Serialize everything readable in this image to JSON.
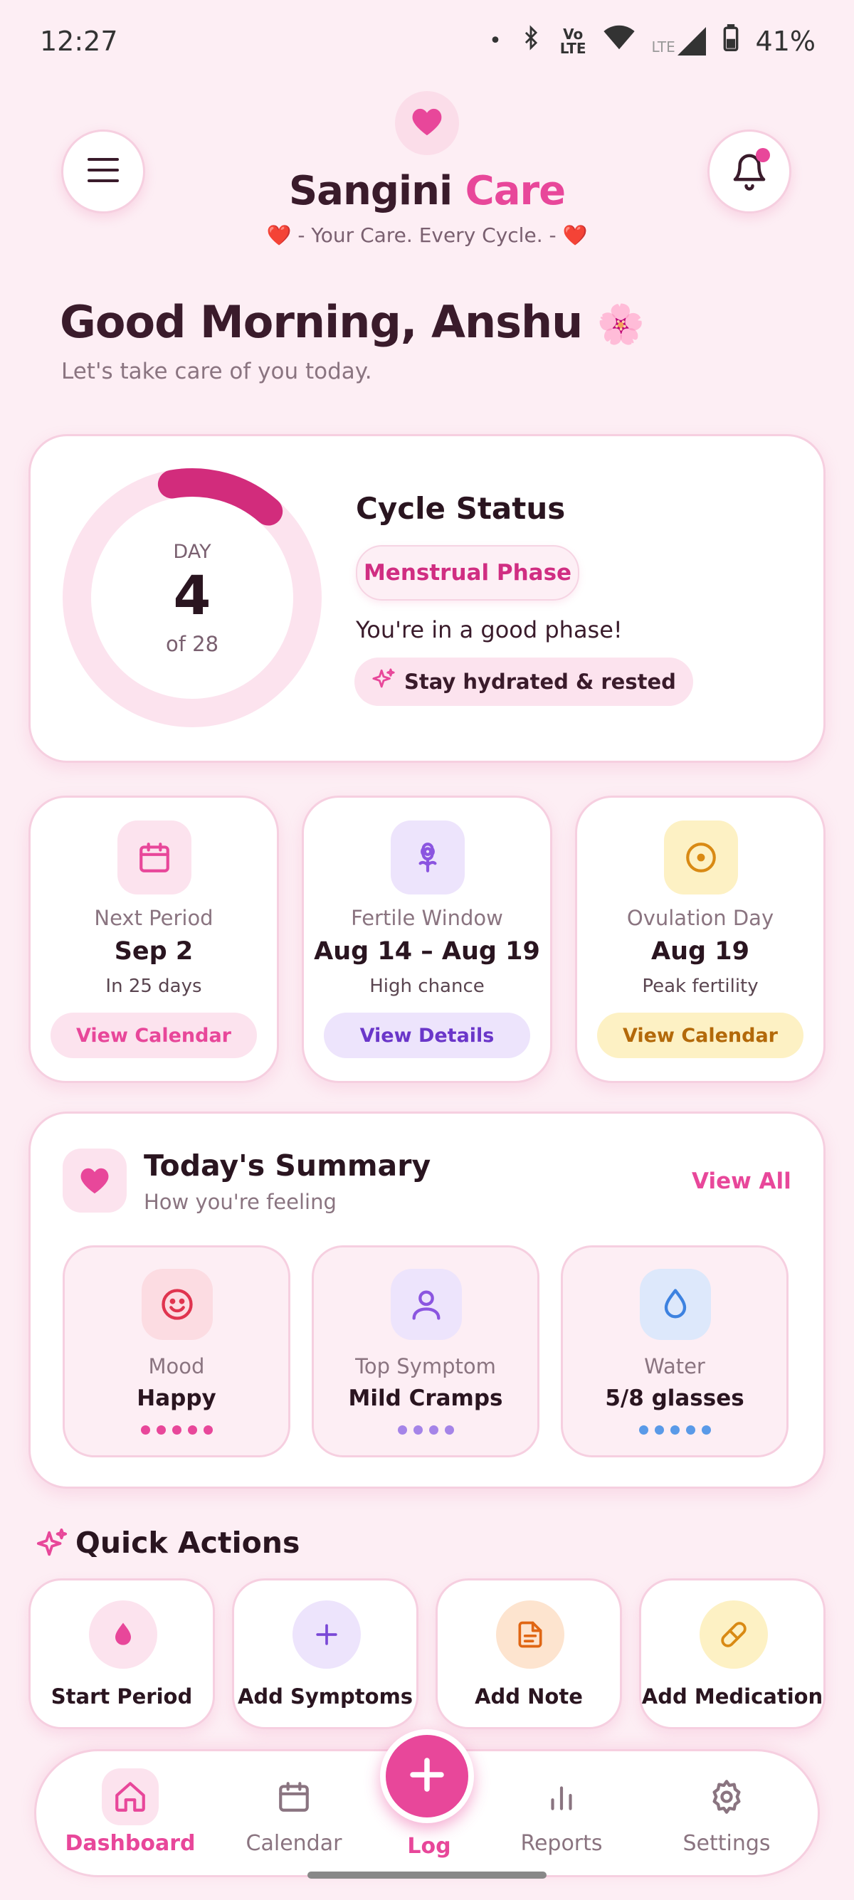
{
  "status_bar": {
    "time": "12:27",
    "dot": "•",
    "volte_top": "Vo",
    "volte_bottom": "LTE",
    "lte": "LTE",
    "battery": "41%"
  },
  "header": {
    "brand_part1": "Sangini",
    "brand_part2": "Care",
    "tagline_heart_left": "❤️",
    "tagline_text": " - Your Care. Every Cycle. - ",
    "tagline_heart_right": "❤️"
  },
  "greeting": {
    "title": "Good Morning, Anshu",
    "emoji": "🌸",
    "subtitle": "Let's take care of you today."
  },
  "cycle": {
    "day_label": "DAY",
    "day": "4",
    "of_label": "of 28",
    "current_day": 4,
    "total_days": 28,
    "title": "Cycle Status",
    "phase": "Menstrual Phase",
    "message": "You're in a good phase!",
    "tip": "Stay hydrated & rested"
  },
  "info_cards": [
    {
      "label": "Next Period",
      "value": "Sep 2",
      "note": "In 25 days",
      "button": "View Calendar",
      "icon": "calendar-icon"
    },
    {
      "label": "Fertile Window",
      "value": "Aug 14 – Aug 19",
      "note": "High chance",
      "button": "View Details",
      "icon": "flower-icon"
    },
    {
      "label": "Ovulation Day",
      "value": "Aug 19",
      "note": "Peak fertility",
      "button": "View Calendar",
      "icon": "target-icon"
    }
  ],
  "summary": {
    "title": "Today's Summary",
    "subtitle": "How you're feeling",
    "view_all": "View All",
    "tiles": [
      {
        "label": "Mood",
        "value": "Happy",
        "dots": 5,
        "icon": "smile-icon"
      },
      {
        "label": "Top Symptom",
        "value": "Mild Cramps",
        "dots": 4,
        "icon": "person-icon"
      },
      {
        "label": "Water",
        "value": "5/8 glasses",
        "dots": 5,
        "icon": "drop-icon"
      }
    ]
  },
  "quick_actions": {
    "title": "Quick Actions",
    "items": [
      {
        "label": "Start Period",
        "icon": "blood-drop-icon"
      },
      {
        "label": "Add Symptoms",
        "icon": "plus-icon"
      },
      {
        "label": "Add Note",
        "icon": "note-icon"
      },
      {
        "label": "Add Medication",
        "icon": "pill-icon"
      }
    ]
  },
  "nav": {
    "items": [
      {
        "label": "Dashboard",
        "active": true
      },
      {
        "label": "Calendar"
      },
      {
        "label": "Log"
      },
      {
        "label": "Reports"
      },
      {
        "label": "Settings"
      }
    ]
  },
  "colors": {
    "accent": "#e8479a",
    "background": "#fdeef4",
    "text": "#3a1b2b"
  }
}
